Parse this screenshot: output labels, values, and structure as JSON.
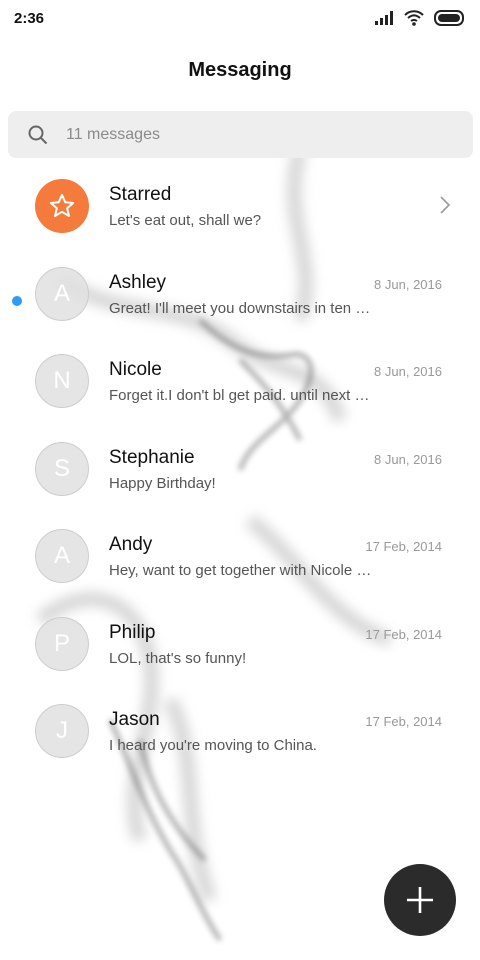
{
  "status_bar": {
    "time": "2:36"
  },
  "header": {
    "title": "Messaging"
  },
  "search": {
    "label": "11 messages"
  },
  "conversations": [
    {
      "name": "Starred",
      "preview": "Let's eat out, shall we?",
      "date": "",
      "avatar": "star-icon",
      "accent": "#f57b3c"
    },
    {
      "name": "Ashley",
      "preview": "Great! I'll meet you downstairs in ten …",
      "date": "8 Jun, 2016",
      "avatar": "A"
    },
    {
      "name": "Nicole",
      "preview": "Forget it.I don't bl get paid. until next …",
      "date": "8 Jun, 2016",
      "avatar": "N"
    },
    {
      "name": "Stephanie",
      "preview": "Happy Birthday!",
      "date": "8 Jun, 2016",
      "avatar": "S",
      "unread": true
    },
    {
      "name": "Andy",
      "preview": "Hey, want to get together with Nicole …",
      "date": "17 Feb, 2014",
      "avatar": "A"
    },
    {
      "name": "Philip",
      "preview": "LOL, that's so funny!",
      "date": "17 Feb, 2014",
      "avatar": "P"
    },
    {
      "name": "Jason",
      "preview": "I heard you're moving to China.",
      "date": "17 Feb, 2014",
      "avatar": "J"
    }
  ],
  "colors": {
    "unread_dot": "#2d9cf4",
    "fab": "#2b2b2b"
  },
  "fab": {
    "icon": "plus-icon"
  }
}
